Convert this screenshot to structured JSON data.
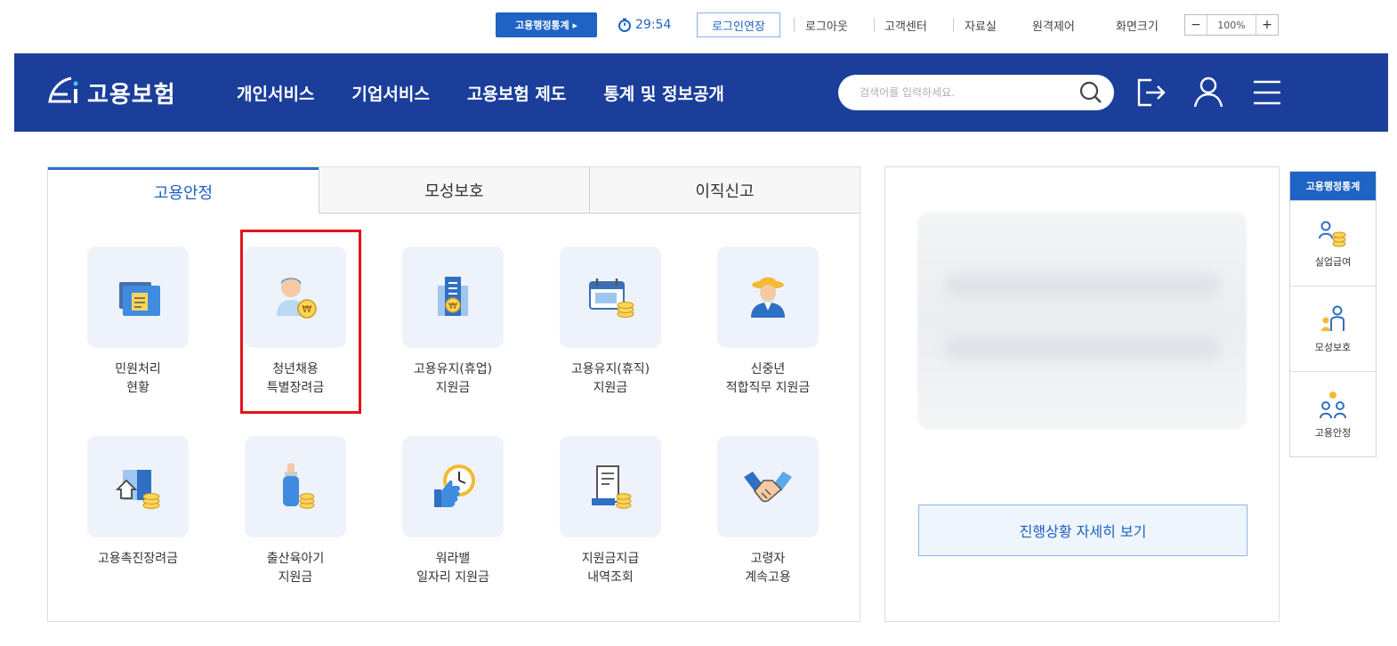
{
  "utility_bar": {
    "stats_button": "고용행정통계 ▸",
    "timer": "29:54",
    "extend_login": "로그인연장",
    "links": [
      "로그아웃",
      "고객센터",
      "자료실",
      "원격제어",
      "화면크기"
    ],
    "zoom": {
      "minus": "−",
      "value": "100%",
      "plus": "+"
    }
  },
  "header": {
    "logo_text": "고용보험",
    "menu": [
      "개인서비스",
      "기업서비스",
      "고용보험 제도",
      "통계 및 정보공개"
    ],
    "search_placeholder": "검색어를 입력하세요.",
    "icons": [
      "search-icon",
      "logout-icon",
      "user-icon",
      "hamburger-menu-icon"
    ]
  },
  "tabs": [
    {
      "label": "고용안정",
      "active": true
    },
    {
      "label": "모성보호",
      "active": false
    },
    {
      "label": "이직신고",
      "active": false
    }
  ],
  "services": [
    {
      "label": "민원처리\n현황",
      "icon": "folder-document-icon"
    },
    {
      "label": "청년채용\n특별장려금",
      "icon": "young-person-coin-icon",
      "highlighted": true
    },
    {
      "label": "고용유지(휴업)\n지원금",
      "icon": "building-coin-icon"
    },
    {
      "label": "고용유지(휴직)\n지원금",
      "icon": "calendar-coins-icon"
    },
    {
      "label": "신중년\n적합직무 지원금",
      "icon": "older-person-hat-icon"
    },
    {
      "label": "고용촉진장려금",
      "icon": "house-coins-icon"
    },
    {
      "label": "출산육아기\n지원금",
      "icon": "baby-bottle-coins-icon"
    },
    {
      "label": "워라밸\n일자리 지원금",
      "icon": "thumbs-up-clock-icon"
    },
    {
      "label": "지원금지급\n내역조회",
      "icon": "receipt-coins-icon"
    },
    {
      "label": "고령자\n계속고용",
      "icon": "handshake-icon"
    }
  ],
  "right_panel": {
    "detail_button": "진행상황 자세히 보기"
  },
  "quick_bar": {
    "title": "고용행정통계",
    "items": [
      {
        "label": "실업급여",
        "icon": "person-coins-icon"
      },
      {
        "label": "모성보호",
        "icon": "mother-child-icon"
      },
      {
        "label": "고용안정",
        "icon": "people-group-icon"
      }
    ]
  },
  "colors": {
    "header_bg": "#1a3e9a",
    "accent_blue": "#1f63c5",
    "highlight_red": "#e2141c",
    "tile_bg": "#eef3fb"
  }
}
